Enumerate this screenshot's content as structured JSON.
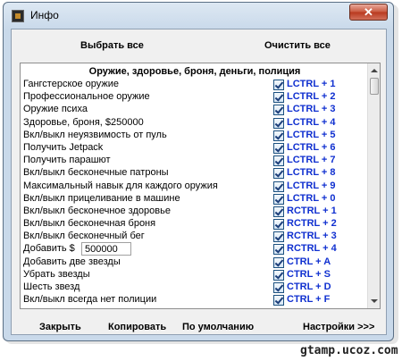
{
  "window": {
    "title": "Инфо",
    "close_label": "✕"
  },
  "toolbar": {
    "select_all": "Выбрать все",
    "clear_all": "Очистить все"
  },
  "list": {
    "header": "Оружие, здоровье, броня, деньги, полиция",
    "items": [
      {
        "label": "Гангстерское оружие",
        "key": "LCTRL + 1",
        "checked": true
      },
      {
        "label": "Профессиональное оружие",
        "key": "LCTRL + 2",
        "checked": true
      },
      {
        "label": "Оружие психа",
        "key": "LCTRL + 3",
        "checked": true
      },
      {
        "label": "Здоровье, броня, $250000",
        "key": "LCTRL + 4",
        "checked": true
      },
      {
        "label": "Вкл/выкл неуязвимость от пуль",
        "key": "LCTRL + 5",
        "checked": true
      },
      {
        "label": "Получить Jetpack",
        "key": "LCTRL + 6",
        "checked": true
      },
      {
        "label": "Получить парашют",
        "key": "LCTRL + 7",
        "checked": true
      },
      {
        "label": "Вкл/выкл бесконечные патроны",
        "key": "LCTRL + 8",
        "checked": true
      },
      {
        "label": "Максимальный навык для каждого оружия",
        "key": "LCTRL + 9",
        "checked": true
      },
      {
        "label": "Вкл/выкл прицеливание в машине",
        "key": "LCTRL + 0",
        "checked": true
      },
      {
        "label": "Вкл/выкл бесконечное здоровье",
        "key": "RCTRL + 1",
        "checked": true
      },
      {
        "label": "Вкл/выкл бесконечная броня",
        "key": "RCTRL + 2",
        "checked": true
      },
      {
        "label": "Вкл/выкл бесконечный бег",
        "key": "RCTRL + 3",
        "checked": true
      },
      {
        "label": "Добавить $",
        "key": "RCTRL + 4",
        "checked": true,
        "input_value": "500000"
      },
      {
        "label": "Добавить две звезды",
        "key": "CTRL + A",
        "checked": true
      },
      {
        "label": "Убрать звезды",
        "key": "CTRL + S",
        "checked": true
      },
      {
        "label": "Шесть звезд",
        "key": "CTRL + D",
        "checked": true
      },
      {
        "label": "Вкл/выкл всегда нет полиции",
        "key": "CTRL + F",
        "checked": true
      }
    ]
  },
  "footer": {
    "close": "Закрыть",
    "copy": "Копировать",
    "default": "По умолчанию",
    "settings": "Настройки >>>"
  },
  "watermark": "gtamp.ucoz.com"
}
